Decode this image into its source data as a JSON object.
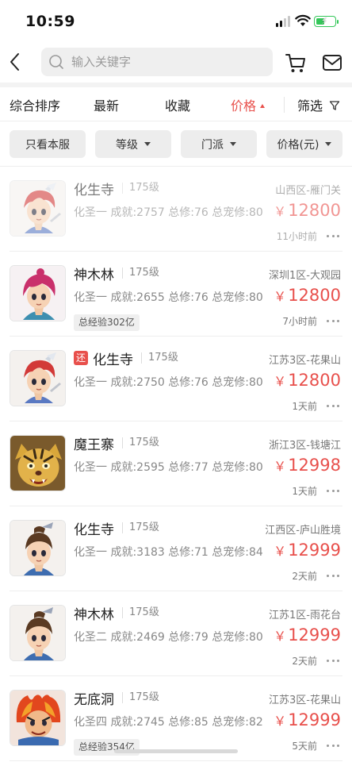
{
  "status_bar": {
    "time": "10:59"
  },
  "header": {
    "search": {
      "placeholder": "输入关键字",
      "value": ""
    },
    "icons": [
      "back-chevron-icon",
      "search-icon",
      "cart-icon",
      "mail-icon"
    ]
  },
  "sort_bar": {
    "items": [
      "综合排序",
      "最新",
      "收藏",
      "价格"
    ],
    "active": "价格",
    "filter_label": "筛选"
  },
  "filter_bar": {
    "chips": [
      "只看本服",
      "等级",
      "门派",
      "价格(元)"
    ]
  },
  "colors": {
    "accent": "#e8504c",
    "chip_bg": "#ededed",
    "muted_text": "#888888"
  },
  "listings": [
    {
      "name": "化生寺",
      "level": "175级",
      "server": "山西区-雁门关",
      "stats": "化圣一 成就:2757 总修:76 总宠修:80",
      "price": "12800",
      "currency": "￥",
      "time": "11小时前",
      "exp": "",
      "returning": false,
      "faded": true,
      "avatar": "red-hair-swordsman"
    },
    {
      "name": "神木林",
      "level": "175级",
      "server": "深圳1区-大观园",
      "stats": "化圣一 成就:2655 总修:76 总宠修:80",
      "price": "12800",
      "currency": "￥",
      "time": "7小时前",
      "exp": "总经验302亿",
      "returning": false,
      "faded": false,
      "avatar": "red-hair-mage"
    },
    {
      "name": "化生寺",
      "level": "175级",
      "server": "江苏3区-花果山",
      "stats": "化圣一 成就:2750 总修:76 总宠修:80",
      "price": "12800",
      "currency": "￥",
      "time": "1天前",
      "exp": "",
      "returning": true,
      "return_tag": "还",
      "faded": false,
      "avatar": "red-hair-swordsman"
    },
    {
      "name": "魔王寨",
      "level": "175级",
      "server": "浙江3区-钱塘江",
      "stats": "化圣一 成就:2595 总修:77 总宠修:80",
      "price": "12998",
      "currency": "￥",
      "time": "1天前",
      "exp": "",
      "returning": false,
      "faded": false,
      "avatar": "tiger-demon"
    },
    {
      "name": "化生寺",
      "level": "175级",
      "server": "江西区-庐山胜境",
      "stats": "化圣一 成就:3183 总修:71 总宠修:84",
      "price": "12999",
      "currency": "￥",
      "time": "2天前",
      "exp": "",
      "returning": false,
      "faded": false,
      "avatar": "brown-hair-boy"
    },
    {
      "name": "神木林",
      "level": "175级",
      "server": "江苏1区-雨花台",
      "stats": "化圣二 成就:2469 总修:79 总宠修:80",
      "price": "12999",
      "currency": "￥",
      "time": "2天前",
      "exp": "",
      "returning": false,
      "faded": false,
      "avatar": "brown-hair-boy"
    },
    {
      "name": "无底洞",
      "level": "175级",
      "server": "江苏3区-花果山",
      "stats": "化圣四 成就:2745 总修:85 总宠修:82",
      "price": "12999",
      "currency": "￥",
      "time": "5天前",
      "exp": "总经验354亿",
      "returning": false,
      "faded": false,
      "avatar": "fire-demon"
    }
  ]
}
